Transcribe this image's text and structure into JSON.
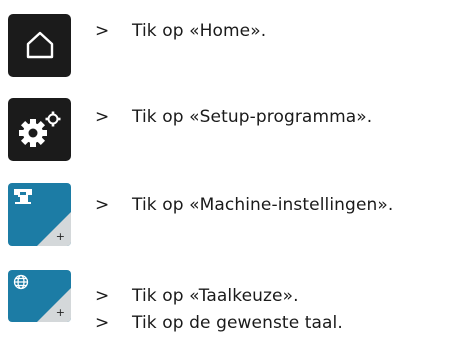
{
  "steps": [
    {
      "icon": "home-icon",
      "marker": ">",
      "text": "Tik op «Home»."
    },
    {
      "icon": "setup-gears-icon",
      "marker": ">",
      "text": "Tik op «Setup-programma»."
    },
    {
      "icon": "sewing-machine-icon",
      "marker": ">",
      "text": "Tik op «Machine-instellingen»."
    },
    {
      "icon": "globe-icon",
      "marker": ">",
      "text": "Tik op «Taalkeuze»."
    },
    {
      "icon": null,
      "marker": ">",
      "text": "Tik op de gewenste taal."
    }
  ],
  "colors": {
    "dark_button": "#1b1b1b",
    "blue_button": "#1c7ca5",
    "corner_tab": "#d4d8da"
  }
}
